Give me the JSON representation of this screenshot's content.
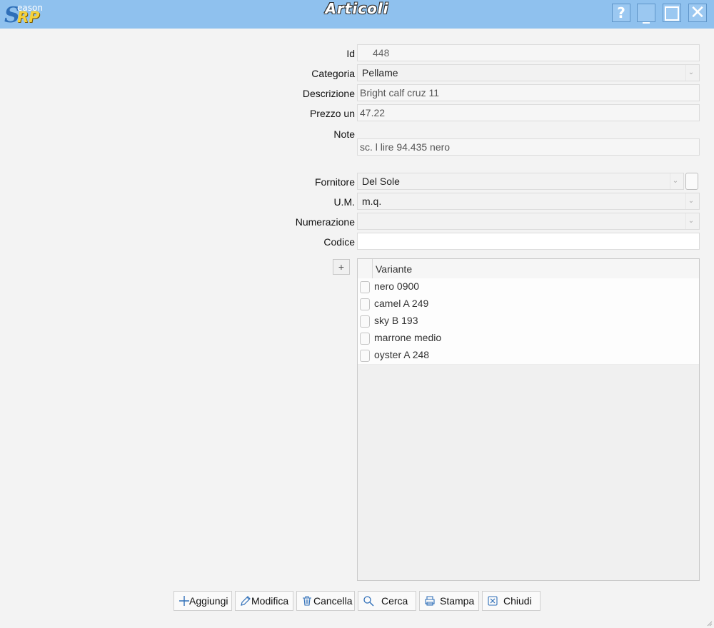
{
  "app": {
    "logo_text": "Season SRP",
    "window_title": "Articoli",
    "help_label": "?",
    "minimize_label": "_",
    "close_label": "✕"
  },
  "form": {
    "id_label": "Id",
    "id_value": "448",
    "categoria_label": "Categoria",
    "categoria_value": "Pellame",
    "descrizione_label": "Descrizione",
    "descrizione_value": "Bright calf cruz 11",
    "prezzo_label": "Prezzo un",
    "prezzo_value": "47.22",
    "note_label": "Note",
    "note_value": "sc. l lire 94.435 nero",
    "fornitore_label": "Fornitore",
    "fornitore_value": "Del Sole",
    "um_label": "U.M.",
    "um_value": "m.q.",
    "numerazione_label": "Numerazione",
    "numerazione_value": "",
    "codice_label": "Codice",
    "codice_value": ""
  },
  "grid": {
    "add_label": "+",
    "header": "Variante",
    "rows": [
      "nero 0900",
      "camel A 249",
      "sky B 193",
      "marrone medio",
      "oyster A 248"
    ]
  },
  "toolbar": {
    "aggiungi": "Aggiungi",
    "modifica": "Modifica",
    "cancella": "Cancella",
    "cerca": "Cerca",
    "stampa": "Stampa",
    "chiudi": "Chiudi"
  },
  "colors": {
    "titlebar": "#8fc1ee",
    "accent_icon": "#2f6fb8"
  }
}
